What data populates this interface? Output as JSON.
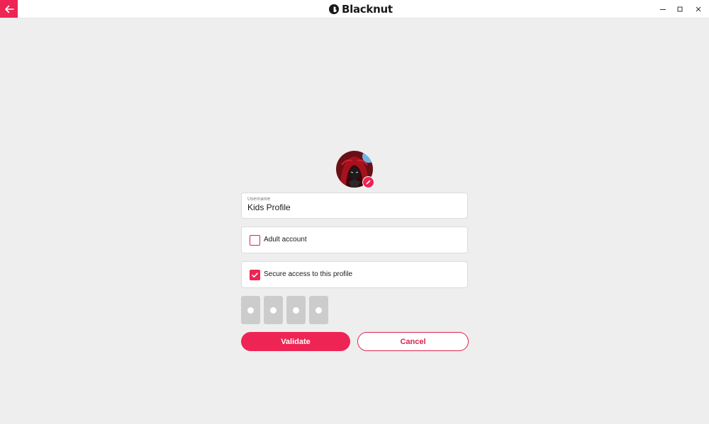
{
  "app": {
    "brand_name": "Blacknut",
    "accent_color": "#ee2454"
  },
  "titlebar": {
    "back_icon": "arrow-left-icon",
    "controls": [
      "minimize-icon",
      "maximize-icon",
      "close-icon"
    ]
  },
  "profile": {
    "avatar_icon": "avatar-hooded-figure",
    "edit_icon": "pencil-icon"
  },
  "form": {
    "username_label": "Username",
    "username_value": "Kids Profile",
    "adult_account_label": "Adult account",
    "adult_account_checked": false,
    "secure_access_label": "Secure access to this profile",
    "secure_access_checked": true,
    "pin_digit_count": 4
  },
  "actions": {
    "validate_label": "Validate",
    "cancel_label": "Cancel"
  }
}
